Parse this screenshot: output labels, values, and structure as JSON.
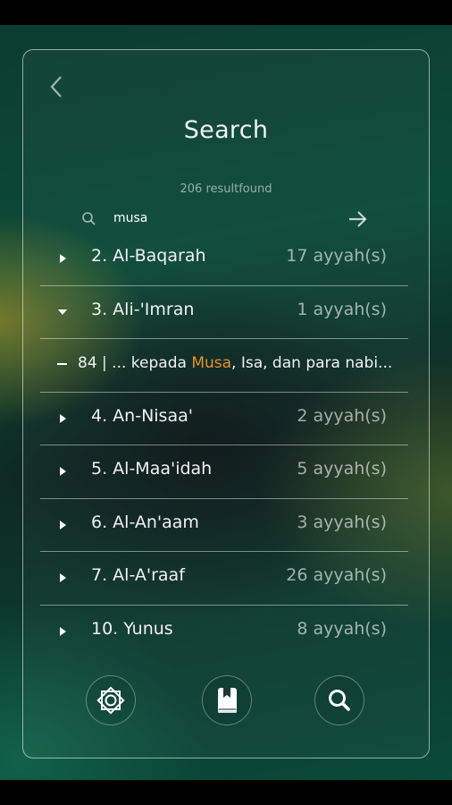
{
  "header": {
    "title": "Search",
    "result_count": "206 resultfound"
  },
  "search": {
    "query": "musa",
    "placeholder": ""
  },
  "results": [
    {
      "name": "2. Al-Baqarah",
      "count": "17 ayyah(s)",
      "expanded": false
    },
    {
      "name": "3. Ali-'Imran",
      "count": "1 ayyah(s)",
      "expanded": true,
      "ayah": {
        "prefix": "84 | ... kepada ",
        "highlight": "Musa",
        "suffix": ", Isa, dan para nabi..."
      }
    },
    {
      "name": "4. An-Nisaa'",
      "count": "2 ayyah(s)",
      "expanded": false
    },
    {
      "name": "5. Al-Maa'idah",
      "count": "5 ayyah(s)",
      "expanded": false
    },
    {
      "name": "6. Al-An'aam",
      "count": "3 ayyah(s)",
      "expanded": false
    },
    {
      "name": "7. Al-A'raaf",
      "count": "26 ayyah(s)",
      "expanded": false
    },
    {
      "name": "10. Yunus",
      "count": "8 ayyah(s)",
      "expanded": false
    }
  ],
  "bottom_nav": [
    {
      "icon": "settings-star-icon"
    },
    {
      "icon": "bookmark-book-icon"
    },
    {
      "icon": "search-icon"
    }
  ],
  "colors": {
    "highlight": "#e7902f",
    "background": "#0b4a38"
  }
}
